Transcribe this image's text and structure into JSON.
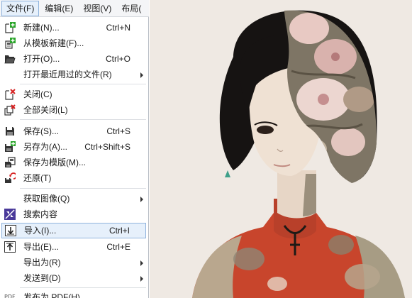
{
  "menubar": {
    "items": [
      {
        "label": "文件(F)"
      },
      {
        "label": "编辑(E)"
      },
      {
        "label": "视图(V)"
      },
      {
        "label": "布局("
      }
    ]
  },
  "file_menu": {
    "items": [
      {
        "label": "新建(N)...",
        "shortcut": "Ctrl+N",
        "icon": "new-document-icon"
      },
      {
        "label": "从模板新建(F)...",
        "shortcut": "",
        "icon": "new-from-template-icon"
      },
      {
        "label": "打开(O)...",
        "shortcut": "Ctrl+O",
        "icon": "folder-open-icon"
      },
      {
        "label": "打开最近用过的文件(R)",
        "shortcut": "",
        "icon": "",
        "submenu": true
      },
      {
        "label": "关闭(C)",
        "shortcut": "",
        "icon": "close-document-icon"
      },
      {
        "label": "全部关闭(L)",
        "shortcut": "",
        "icon": "close-all-icon"
      },
      {
        "label": "保存(S)...",
        "shortcut": "Ctrl+S",
        "icon": "save-icon"
      },
      {
        "label": "另存为(A)...",
        "shortcut": "Ctrl+Shift+S",
        "icon": "save-as-icon"
      },
      {
        "label": "保存为模版(M)...",
        "shortcut": "",
        "icon": "save-template-icon"
      },
      {
        "label": "还原(T)",
        "shortcut": "",
        "icon": "revert-icon"
      },
      {
        "label": "获取图像(Q)",
        "shortcut": "",
        "icon": "",
        "submenu": true
      },
      {
        "label": "搜索内容",
        "shortcut": "",
        "icon": "search-content-icon"
      },
      {
        "label": "导入(I)...",
        "shortcut": "Ctrl+I",
        "icon": "import-icon",
        "highlighted": true
      },
      {
        "label": "导出(E)...",
        "shortcut": "Ctrl+E",
        "icon": "export-icon"
      },
      {
        "label": "导出为(R)",
        "shortcut": "",
        "icon": "",
        "submenu": true
      },
      {
        "label": "发送到(D)",
        "shortcut": "",
        "icon": "",
        "submenu": true
      },
      {
        "label": "发布为 PDF(H)...",
        "shortcut": "",
        "icon": "pdf-icon",
        "icon_text": "PDF"
      }
    ]
  },
  "colors": {
    "highlight_bg": "#e6f0fb",
    "highlight_border": "#8fb3dd",
    "icon_green": "#2aa52a",
    "icon_red": "#d62020",
    "canvas_bg": "#efe9e3",
    "dress_red": "#c8452c",
    "hair_black": "#161312"
  }
}
